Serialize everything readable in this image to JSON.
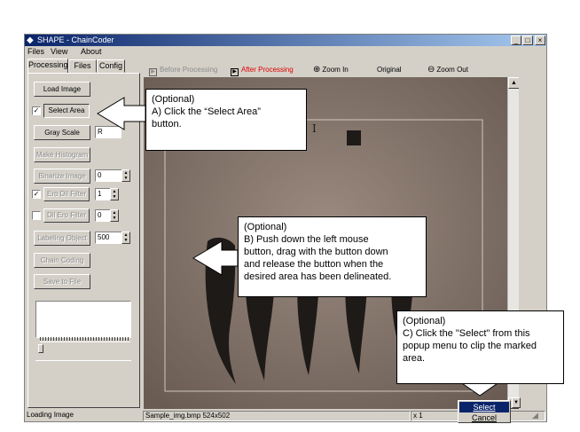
{
  "window": {
    "title": "SHAPE - ChainCoder",
    "buttons": {
      "minimize": "_",
      "maximize": "□",
      "close": "×"
    }
  },
  "menu": {
    "items": [
      "Files",
      "View",
      "About"
    ]
  },
  "tabs": [
    {
      "label": "Processing",
      "active": true
    },
    {
      "label": "Files",
      "active": false
    },
    {
      "label": "Config",
      "active": false
    }
  ],
  "left_panel": {
    "load_image": "Load Image",
    "select_area": {
      "label": "Select Area",
      "checked": true
    },
    "gray_scale": {
      "label": "Gray Scale",
      "value": "R"
    },
    "make_histogram": "Make Histogram",
    "binarize_image": {
      "label": "Binarize Image",
      "value": "0"
    },
    "ero_dil_filter": {
      "label": "Ero Dil Filter",
      "checked": true,
      "value": "1"
    },
    "dil_ero_filter": {
      "label": "Dil Ero Filter",
      "checked": false,
      "value": "0"
    },
    "labeling_object": {
      "label": "Labeling Object",
      "value": "500"
    },
    "chain_coding": "Chain Coding",
    "save_to_file": "Save to File"
  },
  "toolbar": {
    "before_processing": "Before Processing",
    "after_processing": "After Processing",
    "zoom_in": "Zoom In",
    "original": "Original",
    "zoom_out": "Zoom Out",
    "after_processing_color": "#e00000"
  },
  "status": {
    "left": "Loading Image",
    "file": "Sample_img.bmp 524x502",
    "zoom": "x 1"
  },
  "popup_menu": {
    "select": "Select",
    "cancel": "Cancel"
  },
  "callouts": {
    "a": {
      "title": "(Optional)",
      "lines": [
        "A)  Click  the  “Select  Area”",
        "button."
      ]
    },
    "b": {
      "title": "(Optional)",
      "lines": [
        "B)  Push  down  the  left  mouse",
        "button, drag with the button down",
        "and release the button when the",
        "desired area has been delineated."
      ]
    },
    "c": {
      "title": "(Optional)",
      "lines": [
        "C)  Click  the  \"Select\"  from  this",
        "popup menu to clip the marked",
        "area."
      ]
    }
  },
  "colors": {
    "title_bar": "#0a246a",
    "image_background": "#7e6f65",
    "ink": "#1e1a18"
  }
}
